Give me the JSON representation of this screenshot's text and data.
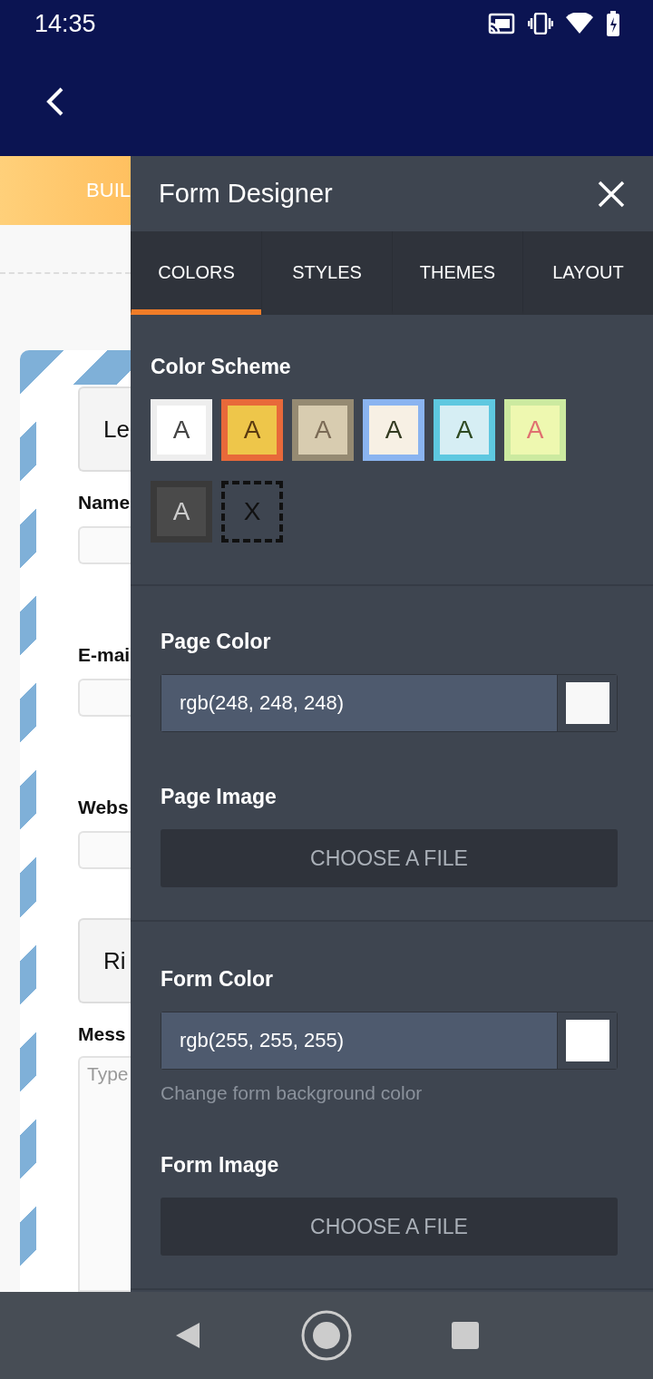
{
  "status_bar": {
    "time": "14:35"
  },
  "background_form": {
    "tab_label": "BUIL",
    "button_1": "Le",
    "fields": [
      {
        "label": "Name"
      },
      {
        "label": "E-mai"
      },
      {
        "label": "Webs"
      }
    ],
    "button_2": "Ri",
    "message_label": "Mess",
    "message_placeholder": "Type"
  },
  "panel": {
    "title": "Form Designer",
    "tabs": [
      {
        "label": "COLORS",
        "selected": true
      },
      {
        "label": "STYLES",
        "selected": false
      },
      {
        "label": "THEMES",
        "selected": false
      },
      {
        "label": "LAYOUT",
        "selected": false
      }
    ],
    "color_scheme": {
      "title": "Color Scheme",
      "swatches": [
        {
          "kind": "swatch",
          "letter": "A",
          "color": "#ffffff"
        },
        {
          "kind": "swatch",
          "letter": "A",
          "color": "#eec64a"
        },
        {
          "kind": "swatch",
          "letter": "A",
          "color": "#d8ccb0"
        },
        {
          "kind": "swatch",
          "letter": "A",
          "color": "#f7f0e4"
        },
        {
          "kind": "swatch",
          "letter": "A",
          "color": "#d6eef4"
        },
        {
          "kind": "swatch",
          "letter": "A",
          "color": "#eef8b0"
        },
        {
          "kind": "swatch",
          "letter": "A",
          "color": "#4a4a4a"
        },
        {
          "kind": "none",
          "letter": "X"
        }
      ]
    },
    "page": {
      "color_label": "Page Color",
      "color_value": "rgb(248, 248, 248)",
      "color": "#f8f8f8",
      "image_label": "Page Image",
      "button": "CHOOSE A FILE"
    },
    "form": {
      "color_label": "Form Color",
      "color_value": "rgb(255, 255, 255)",
      "color": "#ffffff",
      "help": "Change form background color",
      "image_label": "Form Image",
      "button": "CHOOSE A FILE"
    }
  }
}
